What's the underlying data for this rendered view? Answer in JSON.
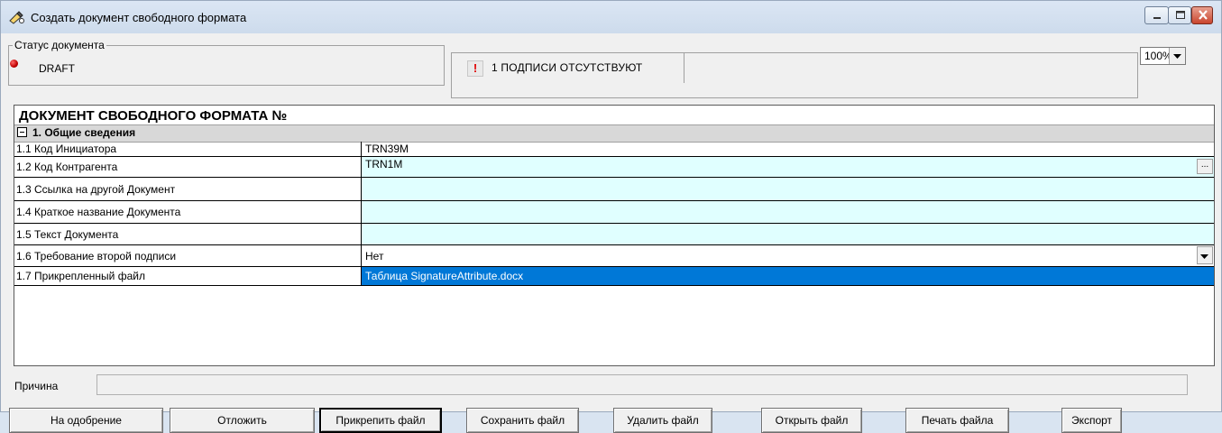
{
  "window": {
    "title": "Создать документ свободного формата",
    "icon": "document-edit-icon"
  },
  "status": {
    "legend": "Статус документа",
    "value": "DRAFT",
    "indicator_color": "#cc0000"
  },
  "signatures": {
    "message": "1 ПОДПИСИ ОТСУТСТВУЮТ",
    "icon_glyph": "!"
  },
  "zoom": {
    "value": "100%"
  },
  "document": {
    "title": "ДОКУМЕНТ СВОБОДНОГО ФОРМАТА №",
    "section": "1. Общие сведения",
    "fields": [
      {
        "label": "1.1 Код Инициатора",
        "value": "TRN39M"
      },
      {
        "label": "1.2 Код Контрагента",
        "value": "TRN1M"
      },
      {
        "label": "1.3 Ссылка на другой Документ",
        "value": ""
      },
      {
        "label": "1.4 Краткое название Документа",
        "value": ""
      },
      {
        "label": "1.5 Текст Документа",
        "value": ""
      },
      {
        "label": "1.6 Требование второй подписи",
        "value": "Нет"
      },
      {
        "label": "1.7 Прикрепленный файл",
        "value": "Таблица SignatureAttribute.docx"
      }
    ],
    "ellipsis": "..."
  },
  "reason": {
    "label": "Причина",
    "value": ""
  },
  "buttons": {
    "approve": "На одобрение",
    "postpone": "Отложить",
    "attach": "Прикрепить файл",
    "save": "Сохранить файл",
    "delete": "Удалить файл",
    "open": "Открыть файл",
    "print": "Печать файла",
    "export": "Экспорт"
  }
}
